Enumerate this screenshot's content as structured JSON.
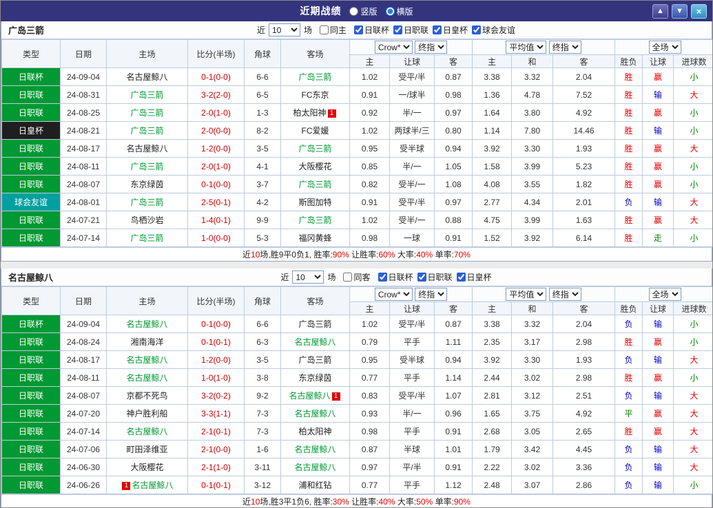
{
  "topbar": {
    "title": "近期战绩",
    "radio_vertical": "竖版",
    "radio_horizontal": "横版",
    "selected_key": "horizontal",
    "buttons": {
      "up": "▲",
      "down": "▼",
      "close": "×"
    }
  },
  "labels": {
    "near": "近",
    "matches": "场"
  },
  "columns": {
    "league": "类型",
    "date": "日期",
    "home": "主场",
    "score": "比分(半场)",
    "corners": "角球",
    "away": "客场",
    "ah_home": "主",
    "ah_line": "让球",
    "ah_away": "客",
    "eu_home": "主",
    "eu_draw": "和",
    "eu_away": "客",
    "result": "胜负",
    "handicap": "让球",
    "goals": "进球数"
  },
  "colors": {
    "accent_green": "#009933",
    "league_teal": "#00a0a0",
    "score_red": "#d30000",
    "lose_blue": "#0000cc"
  },
  "sections": [
    {
      "team": "广岛三箭",
      "filter": {
        "count": "10",
        "same_label": "同主",
        "same_checked": false,
        "leagues": [
          {
            "label": "日联杯",
            "checked": true
          },
          {
            "label": "日职联",
            "checked": true
          },
          {
            "label": "日皇杯",
            "checked": true
          },
          {
            "label": "球会友谊",
            "checked": true
          }
        ]
      },
      "dropdowns": {
        "company": "Crow*",
        "company_time": "终指",
        "europe": "平均值",
        "europe_time": "终指",
        "scope": "全场"
      },
      "rows": [
        {
          "league": "日联杯",
          "league_style": "green",
          "date": "24-09-04",
          "home": {
            "name": "名古屋鲸八",
            "focus": false
          },
          "score": "0-1(0-0)",
          "corners": "6-6",
          "away": {
            "name": "广岛三箭",
            "focus": true
          },
          "ah": [
            "1.02",
            "受平/半",
            "0.87"
          ],
          "eu": [
            "3.38",
            "3.32",
            "2.04"
          ],
          "res": [
            "胜",
            "赢",
            "小"
          ]
        },
        {
          "league": "日职联",
          "league_style": "green",
          "date": "24-08-31",
          "home": {
            "name": "广岛三箭",
            "focus": true
          },
          "score": "3-2(2-0)",
          "corners": "6-5",
          "away": {
            "name": "FC东京",
            "focus": false
          },
          "ah": [
            "0.91",
            "一/球半",
            "0.98"
          ],
          "eu": [
            "1.36",
            "4.78",
            "7.52"
          ],
          "res": [
            "胜",
            "输",
            "大"
          ]
        },
        {
          "league": "日职联",
          "league_style": "green",
          "date": "24-08-25",
          "home": {
            "name": "广岛三箭",
            "focus": true
          },
          "score": "2-0(1-0)",
          "corners": "1-3",
          "away": {
            "name": "柏太阳神",
            "focus": false,
            "card": "1",
            "card_pos": "after"
          },
          "ah": [
            "0.92",
            "半/一",
            "0.97"
          ],
          "eu": [
            "1.64",
            "3.80",
            "4.92"
          ],
          "res": [
            "胜",
            "赢",
            "小"
          ]
        },
        {
          "league": "日皇杯",
          "league_style": "dark",
          "date": "24-08-21",
          "home": {
            "name": "广岛三箭",
            "focus": true
          },
          "score": "2-0(0-0)",
          "corners": "8-2",
          "away": {
            "name": "FC爱媛",
            "focus": false
          },
          "ah": [
            "1.02",
            "两球半/三",
            "0.80"
          ],
          "eu": [
            "1.14",
            "7.80",
            "14.46"
          ],
          "res": [
            "胜",
            "输",
            "小"
          ]
        },
        {
          "league": "日职联",
          "league_style": "green",
          "date": "24-08-17",
          "home": {
            "name": "名古屋鲸八",
            "focus": false
          },
          "score": "1-2(0-0)",
          "corners": "3-5",
          "away": {
            "name": "广岛三箭",
            "focus": true
          },
          "ah": [
            "0.95",
            "受半球",
            "0.94"
          ],
          "eu": [
            "3.92",
            "3.30",
            "1.93"
          ],
          "res": [
            "胜",
            "赢",
            "大"
          ]
        },
        {
          "league": "日职联",
          "league_style": "green",
          "date": "24-08-11",
          "home": {
            "name": "广岛三箭",
            "focus": true
          },
          "score": "2-0(1-0)",
          "corners": "4-1",
          "away": {
            "name": "大阪樱花",
            "focus": false
          },
          "ah": [
            "0.85",
            "半/一",
            "1.05"
          ],
          "eu": [
            "1.58",
            "3.99",
            "5.23"
          ],
          "res": [
            "胜",
            "赢",
            "小"
          ]
        },
        {
          "league": "日职联",
          "league_style": "green",
          "date": "24-08-07",
          "home": {
            "name": "东京绿茵",
            "focus": false
          },
          "score": "0-1(0-0)",
          "corners": "3-7",
          "away": {
            "name": "广岛三箭",
            "focus": true
          },
          "ah": [
            "0.82",
            "受半/一",
            "1.08"
          ],
          "eu": [
            "4.08",
            "3.55",
            "1.82"
          ],
          "res": [
            "胜",
            "赢",
            "小"
          ]
        },
        {
          "league": "球会友谊",
          "league_style": "teal",
          "date": "24-08-01",
          "home": {
            "name": "广岛三箭",
            "focus": true
          },
          "score": "2-5(0-1)",
          "corners": "4-2",
          "away": {
            "name": "斯图加特",
            "focus": false
          },
          "ah": [
            "0.91",
            "受平/半",
            "0.97"
          ],
          "eu": [
            "2.77",
            "4.34",
            "2.01"
          ],
          "res": [
            "负",
            "输",
            "大"
          ]
        },
        {
          "league": "日职联",
          "league_style": "green",
          "date": "24-07-21",
          "home": {
            "name": "鸟栖沙岩",
            "focus": false
          },
          "score": "1-4(0-1)",
          "corners": "9-9",
          "away": {
            "name": "广岛三箭",
            "focus": true
          },
          "ah": [
            "1.02",
            "受半/一",
            "0.88"
          ],
          "eu": [
            "4.75",
            "3.99",
            "1.63"
          ],
          "res": [
            "胜",
            "赢",
            "大"
          ]
        },
        {
          "league": "日职联",
          "league_style": "green",
          "date": "24-07-14",
          "home": {
            "name": "广岛三箭",
            "focus": true
          },
          "score": "1-0(0-0)",
          "corners": "5-3",
          "away": {
            "name": "福冈黄蜂",
            "focus": false
          },
          "ah": [
            "0.98",
            "一球",
            "0.91"
          ],
          "eu": [
            "1.52",
            "3.92",
            "6.14"
          ],
          "res": [
            "胜",
            "走",
            "小"
          ]
        }
      ],
      "summary": [
        {
          "t": "近"
        },
        {
          "t": "10",
          "red": true
        },
        {
          "t": "场,胜9平0负1, "
        },
        {
          "t": "胜率:"
        },
        {
          "t": "90%",
          "red": true
        },
        {
          "t": " 让胜率:"
        },
        {
          "t": "60%",
          "red": true
        },
        {
          "t": " 大率:"
        },
        {
          "t": "40%",
          "red": true
        },
        {
          "t": " 单率:"
        },
        {
          "t": "70%",
          "red": true
        }
      ]
    },
    {
      "team": "名古屋鲸八",
      "filter": {
        "count": "10",
        "same_label": "同客",
        "same_checked": false,
        "leagues": [
          {
            "label": "日联杯",
            "checked": true
          },
          {
            "label": "日职联",
            "checked": true
          },
          {
            "label": "日皇杯",
            "checked": true
          }
        ]
      },
      "dropdowns": {
        "company": "Crow*",
        "company_time": "终指",
        "europe": "平均值",
        "europe_time": "终指",
        "scope": "全场"
      },
      "rows": [
        {
          "league": "日联杯",
          "league_style": "green",
          "date": "24-09-04",
          "home": {
            "name": "名古屋鲸八",
            "focus": true
          },
          "score": "0-1(0-0)",
          "corners": "6-6",
          "away": {
            "name": "广岛三箭",
            "focus": false
          },
          "ah": [
            "1.02",
            "受平/半",
            "0.87"
          ],
          "eu": [
            "3.38",
            "3.32",
            "2.04"
          ],
          "res": [
            "负",
            "输",
            "小"
          ]
        },
        {
          "league": "日职联",
          "league_style": "green",
          "date": "24-08-24",
          "home": {
            "name": "湘南海洋",
            "focus": false
          },
          "score": "0-1(0-1)",
          "corners": "6-3",
          "away": {
            "name": "名古屋鲸八",
            "focus": true
          },
          "ah": [
            "0.79",
            "平手",
            "1.11"
          ],
          "eu": [
            "2.35",
            "3.17",
            "2.98"
          ],
          "res": [
            "胜",
            "赢",
            "小"
          ]
        },
        {
          "league": "日职联",
          "league_style": "green",
          "date": "24-08-17",
          "home": {
            "name": "名古屋鲸八",
            "focus": true
          },
          "score": "1-2(0-0)",
          "corners": "3-5",
          "away": {
            "name": "广岛三箭",
            "focus": false
          },
          "ah": [
            "0.95",
            "受半球",
            "0.94"
          ],
          "eu": [
            "3.92",
            "3.30",
            "1.93"
          ],
          "res": [
            "负",
            "输",
            "大"
          ]
        },
        {
          "league": "日职联",
          "league_style": "green",
          "date": "24-08-11",
          "home": {
            "name": "名古屋鲸八",
            "focus": true
          },
          "score": "1-0(1-0)",
          "corners": "3-8",
          "away": {
            "name": "东京绿茵",
            "focus": false
          },
          "ah": [
            "0.77",
            "平手",
            "1.14"
          ],
          "eu": [
            "2.44",
            "3.02",
            "2.98"
          ],
          "res": [
            "胜",
            "赢",
            "小"
          ]
        },
        {
          "league": "日职联",
          "league_style": "green",
          "date": "24-08-07",
          "home": {
            "name": "京都不死鸟",
            "focus": false
          },
          "score": "3-2(0-2)",
          "corners": "9-2",
          "away": {
            "name": "名古屋鲸八",
            "focus": true,
            "card": "1",
            "card_pos": "after"
          },
          "ah": [
            "0.83",
            "受平/半",
            "1.07"
          ],
          "eu": [
            "2.81",
            "3.12",
            "2.51"
          ],
          "res": [
            "负",
            "输",
            "大"
          ]
        },
        {
          "league": "日职联",
          "league_style": "green",
          "date": "24-07-20",
          "home": {
            "name": "神户胜利船",
            "focus": false
          },
          "score": "3-3(1-1)",
          "corners": "7-3",
          "away": {
            "name": "名古屋鲸八",
            "focus": true
          },
          "ah": [
            "0.93",
            "半/一",
            "0.96"
          ],
          "eu": [
            "1.65",
            "3.75",
            "4.92"
          ],
          "res": [
            "平",
            "赢",
            "大"
          ]
        },
        {
          "league": "日职联",
          "league_style": "green",
          "date": "24-07-14",
          "home": {
            "name": "名古屋鲸八",
            "focus": true
          },
          "score": "2-1(0-1)",
          "corners": "7-3",
          "away": {
            "name": "柏太阳神",
            "focus": false
          },
          "ah": [
            "0.98",
            "平手",
            "0.91"
          ],
          "eu": [
            "2.68",
            "3.05",
            "2.65"
          ],
          "res": [
            "胜",
            "赢",
            "大"
          ]
        },
        {
          "league": "日职联",
          "league_style": "green",
          "date": "24-07-06",
          "home": {
            "name": "町田泽维亚",
            "focus": false
          },
          "score": "2-1(0-0)",
          "corners": "1-6",
          "away": {
            "name": "名古屋鲸八",
            "focus": true
          },
          "ah": [
            "0.87",
            "半球",
            "1.01"
          ],
          "eu": [
            "1.79",
            "3.42",
            "4.45"
          ],
          "res": [
            "负",
            "输",
            "大"
          ]
        },
        {
          "league": "日职联",
          "league_style": "green",
          "date": "24-06-30",
          "home": {
            "name": "大阪樱花",
            "focus": false
          },
          "score": "2-1(1-0)",
          "corners": "3-11",
          "away": {
            "name": "名古屋鲸八",
            "focus": true
          },
          "ah": [
            "0.97",
            "平/半",
            "0.91"
          ],
          "eu": [
            "2.22",
            "3.02",
            "3.36"
          ],
          "res": [
            "负",
            "输",
            "大"
          ]
        },
        {
          "league": "日职联",
          "league_style": "green",
          "date": "24-06-26",
          "home": {
            "name": "名古屋鲸八",
            "focus": true,
            "card": "1",
            "card_pos": "before"
          },
          "score": "0-1(0-1)",
          "corners": "3-12",
          "away": {
            "name": "浦和红钻",
            "focus": false
          },
          "ah": [
            "0.77",
            "平手",
            "1.12"
          ],
          "eu": [
            "2.48",
            "3.07",
            "2.86"
          ],
          "res": [
            "负",
            "输",
            "小"
          ]
        }
      ],
      "summary": [
        {
          "t": "近"
        },
        {
          "t": "10",
          "red": true
        },
        {
          "t": "场,胜3平1负6, "
        },
        {
          "t": "胜率:"
        },
        {
          "t": "30%",
          "red": true
        },
        {
          "t": " 让胜率:"
        },
        {
          "t": "40%",
          "red": true
        },
        {
          "t": " 大率:"
        },
        {
          "t": "50%",
          "red": true
        },
        {
          "t": " 单率:"
        },
        {
          "t": "90%",
          "red": true
        }
      ]
    }
  ]
}
